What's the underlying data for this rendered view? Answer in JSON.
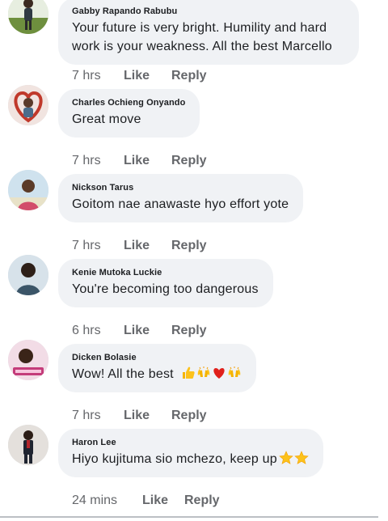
{
  "comments": [
    {
      "author": "Gabby Rapando Rabubu",
      "text": "Your future is very bright. Humility and hard work is your weakness. All the best Marcello",
      "time": "7 hrs",
      "like": "Like",
      "reply": "Reply",
      "avatar_color": "#5a7a3a"
    },
    {
      "author": "Charles Ochieng Onyando",
      "text": "Great move",
      "time": "7 hrs",
      "like": "Like",
      "reply": "Reply",
      "avatar_color": "#b5473d"
    },
    {
      "author": "Nickson Tarus",
      "text": "Goitom nae anawaste hyo effort yote",
      "time": "7 hrs",
      "like": "Like",
      "reply": "Reply",
      "avatar_color": "#8fb6c8"
    },
    {
      "author": "Kenie Mutoka Luckie",
      "text": "You're becoming too dangerous",
      "time": "6 hrs",
      "like": "Like",
      "reply": "Reply",
      "avatar_color": "#6d8fa6"
    },
    {
      "author": "Dicken Bolasie",
      "text": "Wow! All the best",
      "time": "7 hrs",
      "like": "Like",
      "reply": "Reply",
      "avatar_color": "#c97aa0",
      "emojis": [
        "thumbs-up",
        "raising-hands",
        "red-heart",
        "raising-hands"
      ]
    },
    {
      "author": "Haron Lee",
      "text": "Hiyo kujituma sio mchezo, keep up",
      "time": "24 mins",
      "like": "Like",
      "reply": "Reply",
      "avatar_color": "#9a8f88",
      "emojis": [
        "star",
        "star"
      ]
    }
  ],
  "colors": {
    "bubble": "#f0f2f5",
    "meta_text": "#65676b",
    "body_text": "#1c1e21"
  }
}
